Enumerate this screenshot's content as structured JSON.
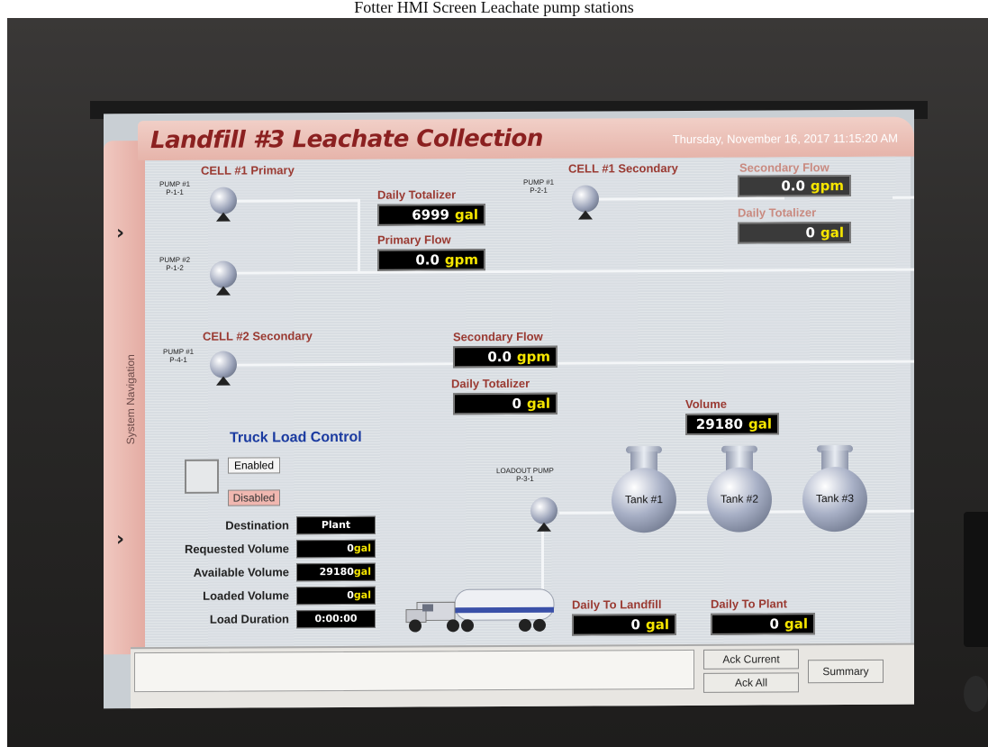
{
  "caption": "Fotter HMI Screen Leachate pump stations",
  "header": {
    "title": "Landfill #3 Leachate Collection",
    "datetime": "Thursday, November 16, 2017 11:15:20 AM"
  },
  "sidenav": {
    "label": "System Navigation",
    "arrow": "›"
  },
  "cell1_primary": {
    "title": "CELL #1 Primary",
    "pump1_label": "PUMP #1\nP-1-1",
    "pump2_label": "PUMP #2\nP-1-2",
    "daily_totalizer_label": "Daily Totalizer",
    "daily_totalizer_value": "6999",
    "daily_totalizer_unit": "gal",
    "primary_flow_label": "Primary Flow",
    "primary_flow_value": "0.0",
    "primary_flow_unit": "gpm"
  },
  "cell1_secondary": {
    "title": "CELL #1 Secondary",
    "pump1_label": "PUMP #1\nP-2-1",
    "secondary_flow_label": "Secondary Flow",
    "secondary_flow_value": "0.0",
    "secondary_flow_unit": "gpm",
    "daily_totalizer_label": "Daily Totalizer",
    "daily_totalizer_value": "0",
    "daily_totalizer_unit": "gal"
  },
  "cell2_secondary": {
    "title": "CELL #2 Secondary",
    "pump1_label": "PUMP #1\nP-4-1",
    "secondary_flow_label": "Secondary Flow",
    "secondary_flow_value": "0.0",
    "secondary_flow_unit": "gpm",
    "daily_totalizer_label": "Daily Totalizer",
    "daily_totalizer_value": "0",
    "daily_totalizer_unit": "gal"
  },
  "tanks": {
    "volume_label": "Volume",
    "volume_value": "29180",
    "volume_unit": "gal",
    "loadout_label": "LOADOUT PUMP\nP-3-1",
    "tank1": "Tank #1",
    "tank2": "Tank #2",
    "tank3": "Tank #3"
  },
  "truck_load": {
    "title": "Truck Load Control",
    "enabled_label": "Enabled",
    "disabled_label": "Disabled",
    "destination_label": "Destination",
    "destination_value": "Plant",
    "requested_label": "Requested Volume",
    "requested_value": "0",
    "available_label": "Available Volume",
    "available_value": "29180",
    "loaded_label": "Loaded Volume",
    "loaded_value": "0",
    "duration_label": "Load Duration",
    "duration_value": "0:00:00",
    "unit": "gal"
  },
  "daily": {
    "landfill_label": "Daily To Landfill",
    "landfill_value": "0",
    "plant_label": "Daily To Plant",
    "plant_value": "0",
    "unit": "gal"
  },
  "buttons": {
    "ack_current": "Ack Current",
    "ack_all": "Ack All",
    "summary": "Summary"
  },
  "colors": {
    "header_bg": "#e6b4aa",
    "label_red": "#9a3a32",
    "value_yellow": "#f5e500",
    "truck_title_blue": "#1a3aa0"
  }
}
